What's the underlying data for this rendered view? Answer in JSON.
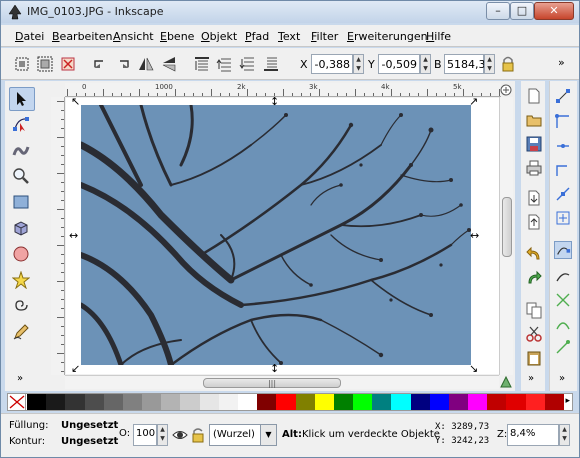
{
  "window": {
    "title": "IMG_0103.JPG - Inkscape",
    "min_label": "–",
    "max_label": "□",
    "close_label": "✕"
  },
  "menu": [
    "Datei",
    "Bearbeiten",
    "Ansicht",
    "Ebene",
    "Objekt",
    "Pfad",
    "Text",
    "Filter",
    "Erweiterungen",
    "Hilfe"
  ],
  "controls": {
    "x_label": "X",
    "x_value": "-0,388",
    "y_label": "Y",
    "y_value": "-0,509",
    "b_label": "B",
    "b_value": "5184,38"
  },
  "rulers": {
    "h_labels": [
      "0",
      "1000",
      "2k",
      "3k",
      "4k",
      "5k"
    ]
  },
  "palette": {
    "colors": [
      "#000000",
      "#1a1a1a",
      "#333333",
      "#4d4d4d",
      "#666666",
      "#808080",
      "#999999",
      "#b3b3b3",
      "#cccccc",
      "#e6e6e6",
      "#f2f2f2",
      "#ffffff",
      "#800000",
      "#ff0000",
      "#808000",
      "#ffff00",
      "#008000",
      "#00ff00",
      "#008080",
      "#00ffff",
      "#000080",
      "#0000ff",
      "#800080",
      "#ff00ff",
      "#c00000",
      "#e00000",
      "#ff2020",
      "#b00000"
    ]
  },
  "status": {
    "fill_label": "Füllung:",
    "fill_value": "Ungesetzt",
    "stroke_label": "Kontur:",
    "stroke_value": "Ungesetzt",
    "opacity_label": "O:",
    "opacity_value": "100",
    "layer": "(Wurzel)",
    "message_bold": "Alt:",
    "message": "Klick um verdeckte Objekte",
    "x_readout": "X: 3289,73",
    "y_readout": "Y: 3242,23",
    "zoom_label": "Z:",
    "zoom_value": "8,4%"
  },
  "colors": {
    "photo_sky": "#6c92b7",
    "branch": "#2a2c33",
    "selection_bg": "#c3d6ef"
  }
}
